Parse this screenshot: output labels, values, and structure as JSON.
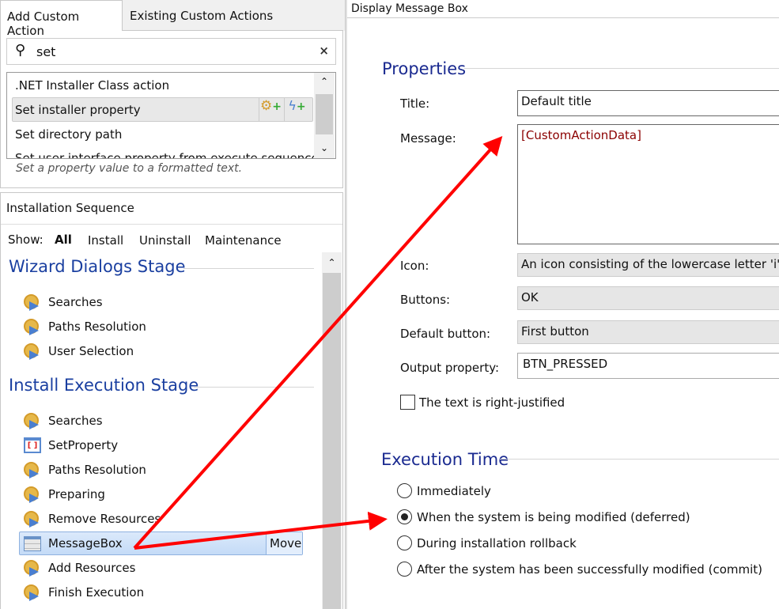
{
  "tabs": [
    {
      "label": "Add Custom Action",
      "active": true
    },
    {
      "label": "Existing Custom Actions",
      "active": false
    }
  ],
  "search": {
    "value": "set",
    "icon": "search-icon",
    "clear_icon": "close-icon"
  },
  "actions": {
    "items": [
      ".NET Installer Class action",
      "Set installer property",
      "Set directory path",
      "Set user interface property from execute sequence"
    ],
    "selected": 1,
    "description": "Set a property value to a formatted text."
  },
  "sequence": {
    "title": "Installation Sequence",
    "show_label": "Show:",
    "filters": [
      "All",
      "Install",
      "Uninstall",
      "Maintenance"
    ],
    "active_filter": "All",
    "stages": [
      {
        "title": "Wizard Dialogs Stage",
        "items": [
          "Searches",
          "Paths Resolution",
          "User Selection"
        ]
      },
      {
        "title": "Install Execution Stage",
        "items": [
          "Searches",
          "SetProperty",
          "Paths Resolution",
          "Preparing",
          "Remove Resources",
          "MessageBox",
          "Add Resources",
          "Finish Execution"
        ]
      }
    ],
    "selected_item": "MessageBox",
    "move_label": "Move"
  },
  "panel": {
    "title": "Display Message Box",
    "properties_header": "Properties",
    "fields": {
      "title_label": "Title:",
      "title_value": "Default title",
      "message_label": "Message:",
      "message_value": "[CustomActionData]",
      "icon_label": "Icon:",
      "icon_value": "An icon consisting of the lowercase letter 'i' in",
      "buttons_label": "Buttons:",
      "buttons_value": "OK",
      "default_label": "Default button:",
      "default_value": "First button",
      "output_label": "Output property:",
      "output_value": "BTN_PRESSED"
    },
    "right_justified_label": "The text is right-justified",
    "right_justified": false,
    "execution_header": "Execution Time",
    "execution_options": [
      "Immediately",
      "When the system is being modified (deferred)",
      "During installation rollback",
      "After the system has been successfully modified (commit)"
    ],
    "execution_selected": 1
  },
  "colors": {
    "header": "#1a2a90",
    "stage": "#1a3fa0",
    "message_text": "#8b0000",
    "annotation_arrow": "#ff0000",
    "selected_row": "#cfe2fa"
  }
}
